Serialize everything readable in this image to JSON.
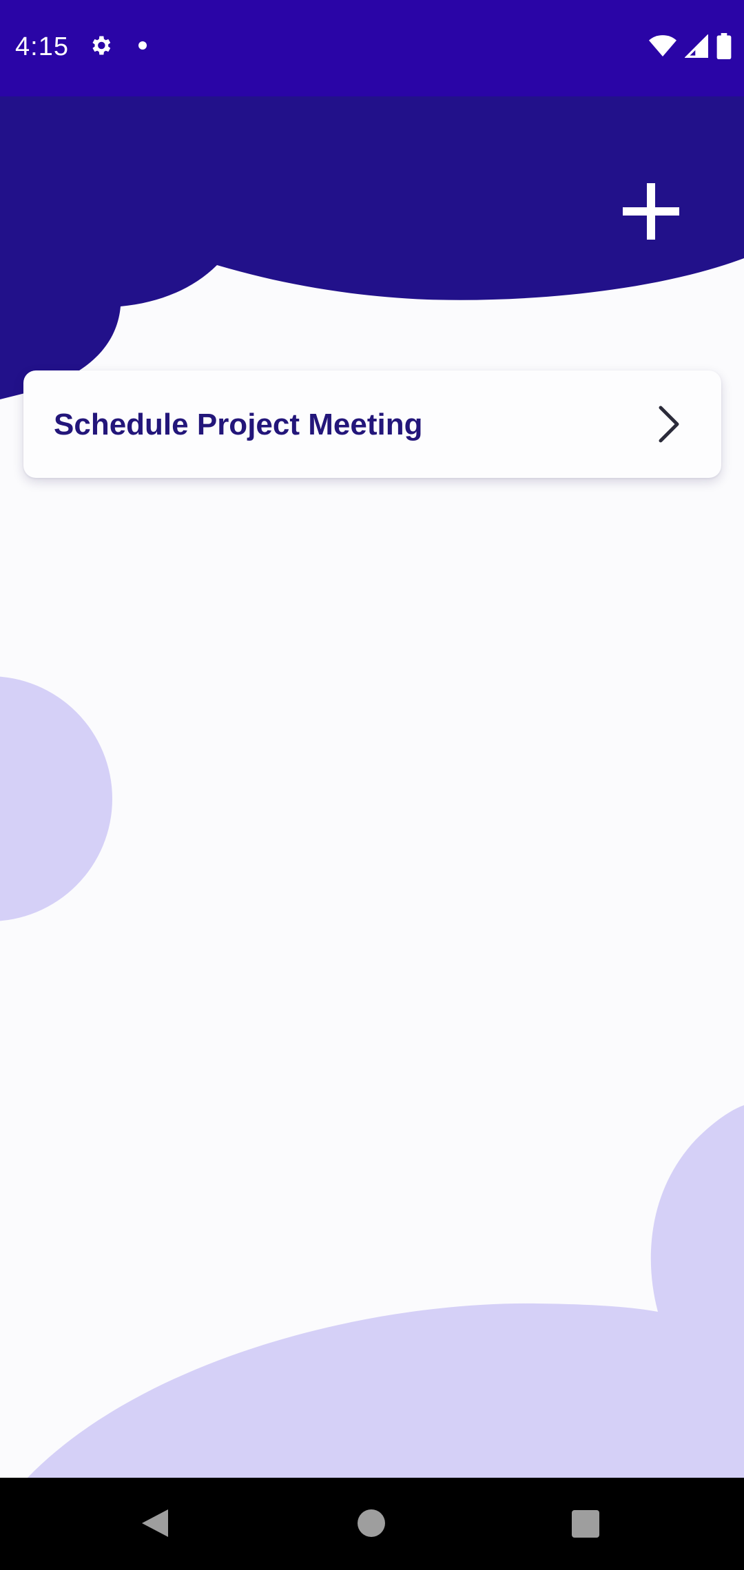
{
  "status_bar": {
    "time": "4:15",
    "left_icons": [
      "settings-gear-icon",
      "notification-dot-icon"
    ],
    "right_icons": [
      "wifi-icon",
      "cell-signal-icon",
      "battery-icon"
    ]
  },
  "header": {
    "add_button_icon": "plus-icon"
  },
  "list": {
    "items": [
      {
        "title": "Schedule Project Meeting",
        "trailing_icon": "chevron-right-icon"
      }
    ]
  },
  "nav_bar": {
    "buttons": [
      "back-icon",
      "home-icon",
      "recents-icon"
    ]
  },
  "colors": {
    "primary_dark": "#2a05a6",
    "header_blob": "#22118a",
    "title_text": "#23167a",
    "background": "#fbfbfd",
    "accent_light": "#d5d0f7"
  }
}
